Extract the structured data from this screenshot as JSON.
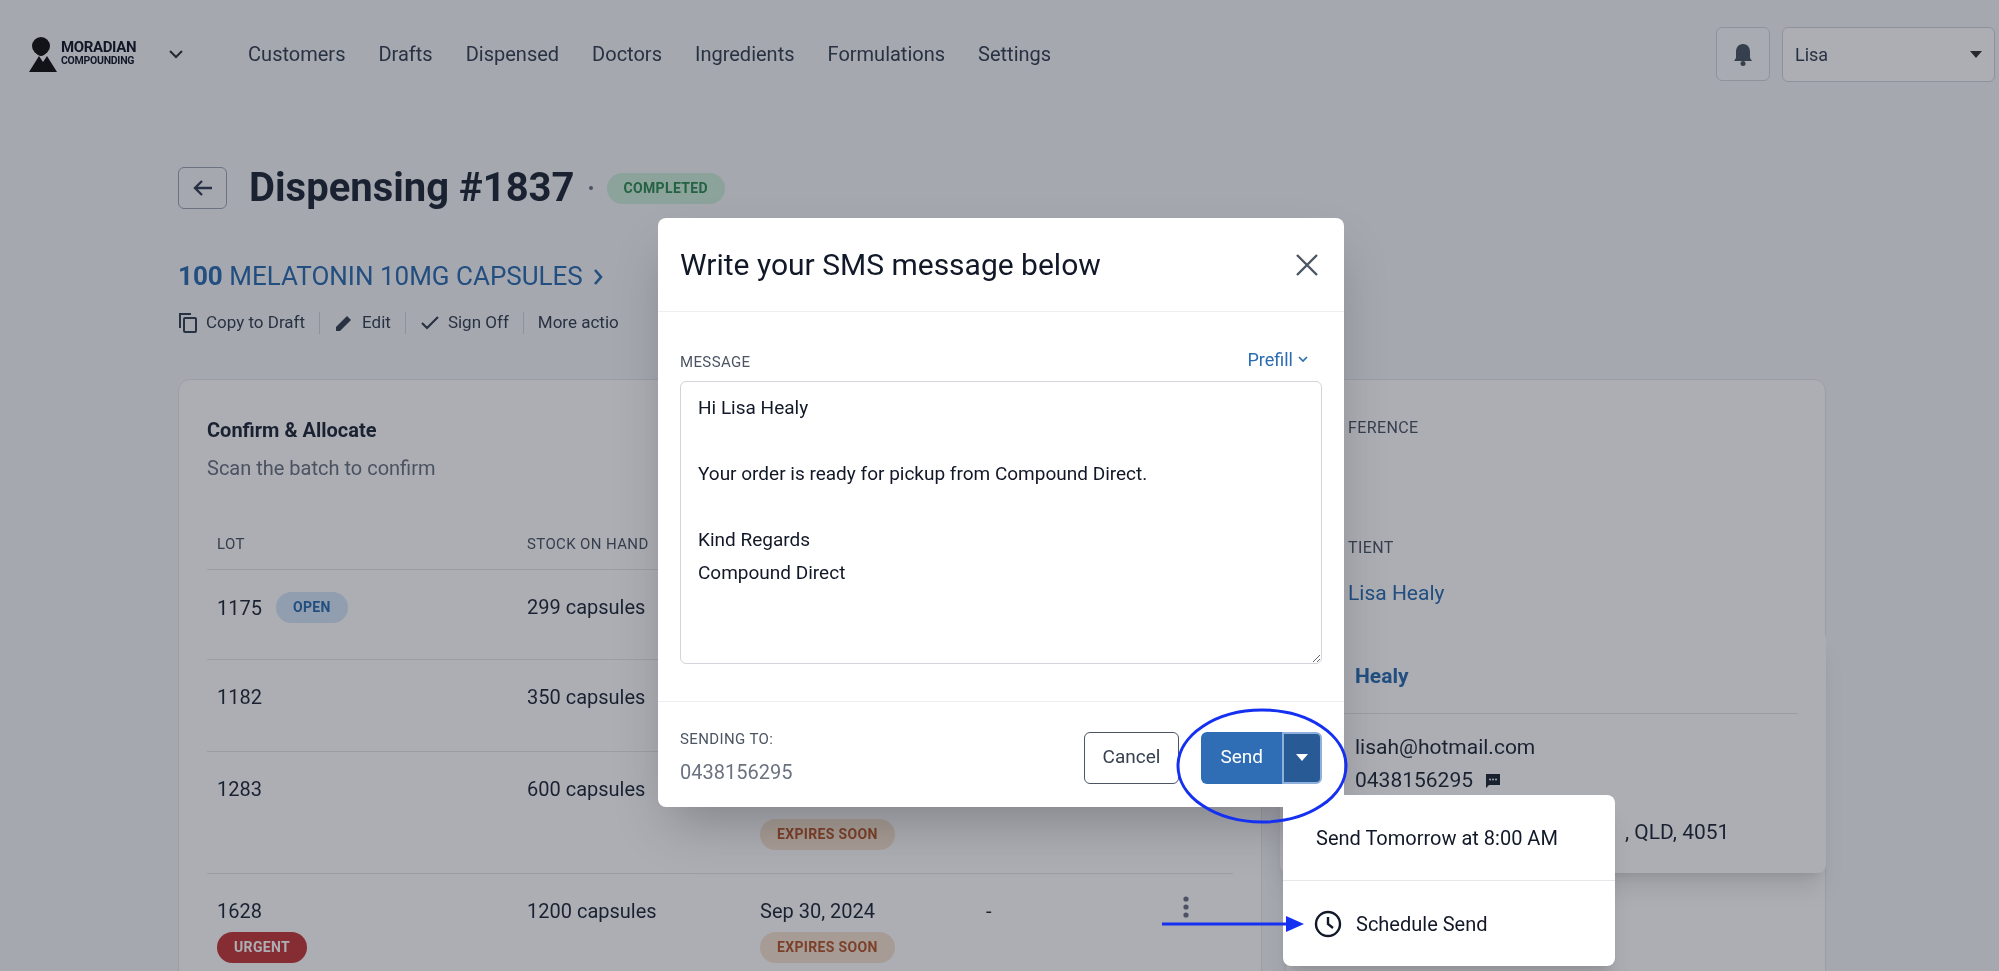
{
  "nav": {
    "logo": {
      "line_1": "MORADIAN",
      "line_2": "COMPOUNDING"
    },
    "items": [
      {
        "label": "Customers"
      },
      {
        "label": "Drafts"
      },
      {
        "label": "Dispensed"
      },
      {
        "label": "Doctors"
      },
      {
        "label": "Ingredients"
      },
      {
        "label": "Formulations"
      },
      {
        "label": "Settings"
      }
    ],
    "user_select": {
      "value": "Lisa"
    }
  },
  "header": {
    "title": "Dispensing #1837",
    "status": {
      "text": "COMPLETED",
      "kind": "completed"
    },
    "product": {
      "quantity": "100",
      "name": "MELATONIN 10MG CAPSULES"
    },
    "actions": [
      {
        "label": "Copy to Draft",
        "kind": "copy"
      },
      {
        "label": "Edit",
        "kind": "edit"
      },
      {
        "label": "Sign Off",
        "kind": "check"
      },
      {
        "label": "More actio",
        "kind": "text"
      }
    ]
  },
  "allocate_card": {
    "title": "Confirm & Allocate",
    "subtitle": "Scan the batch to confirm",
    "columns": [
      "LOT",
      "STOCK ON HAND"
    ],
    "rows": [
      {
        "lot": "1175",
        "lot_badge": {
          "text": "OPEN",
          "kind": "open"
        },
        "stock": "299 capsules"
      },
      {
        "lot": "1182",
        "stock": "350 capsules"
      },
      {
        "lot": "1283",
        "stock": "600 capsules",
        "expiry_badge": {
          "text": "EXPIRES SOON",
          "kind": "expires"
        }
      },
      {
        "lot": "1628",
        "lot_badge": {
          "text": "URGENT",
          "kind": "urgent"
        },
        "stock": "1200 capsules",
        "expiry": "Sep 30, 2024",
        "expiry_badge": {
          "text": "EXPIRES SOON",
          "kind": "expires"
        },
        "column_4": "-"
      }
    ]
  },
  "reference_card": {
    "reference_label": "FERENCE",
    "patient_label": "TIENT",
    "patient_name": "Lisa Healy"
  },
  "customer_popover": {
    "name": "Healy",
    "email": "lisah@hotmail.com",
    "phone": "0438156295",
    "address": ", QLD, 4051"
  },
  "sms_modal": {
    "title": "Write your SMS message below",
    "message_label": "MESSAGE",
    "prefill": "Prefill",
    "message": "Hi Lisa Healy\n\nYour order is ready for pickup from Compound Direct.\n\nKind Regards\nCompound Direct",
    "sending_to_label": "SENDING TO:",
    "phone": "0438156295",
    "cancel": "Cancel",
    "send": "Send"
  },
  "send_menu": {
    "items": [
      {
        "label": "Send Tomorrow at 8:00 AM",
        "kind": "plain"
      },
      {
        "label": "Schedule Send",
        "kind": "clock"
      }
    ]
  }
}
